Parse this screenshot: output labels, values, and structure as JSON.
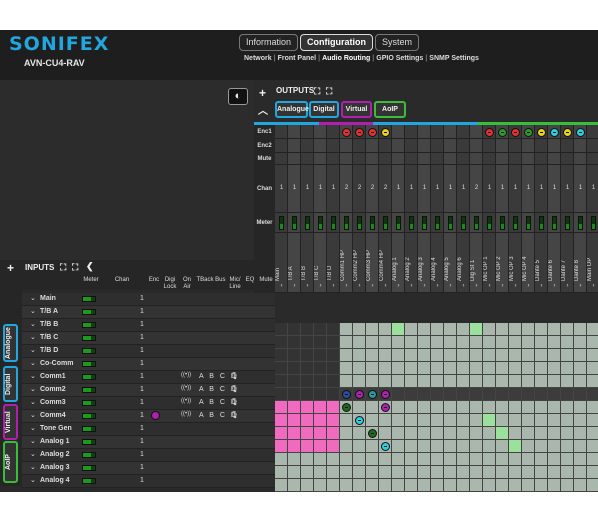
{
  "header": {
    "logo": "SONIFEX",
    "device": "AVN-CU4-RAV",
    "tabs": [
      {
        "label": "Information"
      },
      {
        "label": "Configuration",
        "active": true
      },
      {
        "label": "System"
      }
    ],
    "subnav": [
      {
        "label": "Network"
      },
      {
        "label": "Front Panel"
      },
      {
        "label": "Audio Routing",
        "active": true
      },
      {
        "label": "GPIO Settings"
      },
      {
        "label": "SNMP Settings"
      }
    ]
  },
  "outputs": {
    "title": "OUTPUTS",
    "filters": [
      {
        "label": "Analogue",
        "color": "#22a6e0"
      },
      {
        "label": "Digital",
        "color": "#22a6e0"
      },
      {
        "label": "Virtual",
        "color": "#b01fb0"
      },
      {
        "label": "AoIP",
        "color": "#3bbd3b"
      }
    ],
    "row_labels": {
      "enc1": "Enc1",
      "enc2": "Enc2",
      "mute": "Mute",
      "chan": "Chan",
      "meter": "Meter"
    },
    "columns": [
      {
        "name": "Main",
        "chan": "1"
      },
      {
        "name": "T/B A",
        "chan": "1"
      },
      {
        "name": "T/B B",
        "chan": "1"
      },
      {
        "name": "T/B C",
        "chan": "1"
      },
      {
        "name": "T/B D",
        "chan": "1"
      },
      {
        "name": "Comm1 HP",
        "chan": "2",
        "enc1": "red"
      },
      {
        "name": "Comm2 HP",
        "chan": "2",
        "enc1": "red"
      },
      {
        "name": "Comm3 HP",
        "chan": "2",
        "enc1": "red"
      },
      {
        "name": "Comm4 HP",
        "chan": "2",
        "enc1": "yellow"
      },
      {
        "name": "Analog 1",
        "chan": "1"
      },
      {
        "name": "Analog 2",
        "chan": "1"
      },
      {
        "name": "Analog 3",
        "chan": "1"
      },
      {
        "name": "Analog 4",
        "chan": "1"
      },
      {
        "name": "Analog 5",
        "chan": "1"
      },
      {
        "name": "Analog 6",
        "chan": "1"
      },
      {
        "name": "Dig St 1",
        "chan": "2"
      },
      {
        "name": "Mic OP 1",
        "chan": "1",
        "enc1": "red"
      },
      {
        "name": "Mic OP 2",
        "chan": "1",
        "enc1": "green"
      },
      {
        "name": "Mic OP 3",
        "chan": "1",
        "enc1": "red"
      },
      {
        "name": "Mic OP 4",
        "chan": "1",
        "enc1": "green"
      },
      {
        "name": "Dante 5",
        "chan": "1",
        "enc1": "yellow"
      },
      {
        "name": "Dante 6",
        "chan": "1",
        "enc1": "cyan"
      },
      {
        "name": "Dante 7",
        "chan": "1",
        "enc1": "yellow"
      },
      {
        "name": "Dante 8",
        "chan": "1",
        "enc1": "cyan"
      },
      {
        "name": "Main OP",
        "chan": "1"
      }
    ]
  },
  "inputs": {
    "title": "INPUTS",
    "headers": {
      "meter": "Meter",
      "chan": "Chan",
      "enc": "Enc",
      "digi": "Digi Lock",
      "onair": "On Air",
      "tback": "TBack Bus",
      "mic": "Mic/ Line",
      "eq": "EQ",
      "mute": "Mute"
    },
    "tabs": [
      {
        "label": "Analogue",
        "color": "#22a6e0"
      },
      {
        "label": "Digital",
        "color": "#22a6e0"
      },
      {
        "label": "Virtual",
        "color": "#b01fb0"
      },
      {
        "label": "AoIP",
        "color": "#3bbd3b"
      }
    ],
    "rows": [
      {
        "name": "Main",
        "chan": "1"
      },
      {
        "name": "T/B A",
        "chan": "1"
      },
      {
        "name": "T/B B",
        "chan": "1"
      },
      {
        "name": "T/B C",
        "chan": "1"
      },
      {
        "name": "T/B D",
        "chan": "1"
      },
      {
        "name": "Co-Comm",
        "chan": "1"
      },
      {
        "name": "Comm1",
        "chan": "1",
        "tb": "A B C D",
        "onair": true
      },
      {
        "name": "Comm2",
        "chan": "1",
        "tb": "A B C D",
        "onair": true
      },
      {
        "name": "Comm3",
        "chan": "1",
        "tb": "A B C D",
        "onair": true
      },
      {
        "name": "Comm4",
        "chan": "1",
        "tb": "A B C D",
        "onair": true,
        "enc": "5"
      },
      {
        "name": "Tone Gen",
        "chan": "1"
      },
      {
        "name": "Analog 1",
        "chan": "1"
      },
      {
        "name": "Analog 2",
        "chan": "1"
      },
      {
        "name": "Analog 3",
        "chan": "1"
      },
      {
        "name": "Analog 4",
        "chan": "1"
      }
    ]
  },
  "colors": {
    "pink": "#f06bbf",
    "green_route": "#9be09b",
    "grid_light": "#a9b7ad",
    "grid_dark": "#333"
  }
}
